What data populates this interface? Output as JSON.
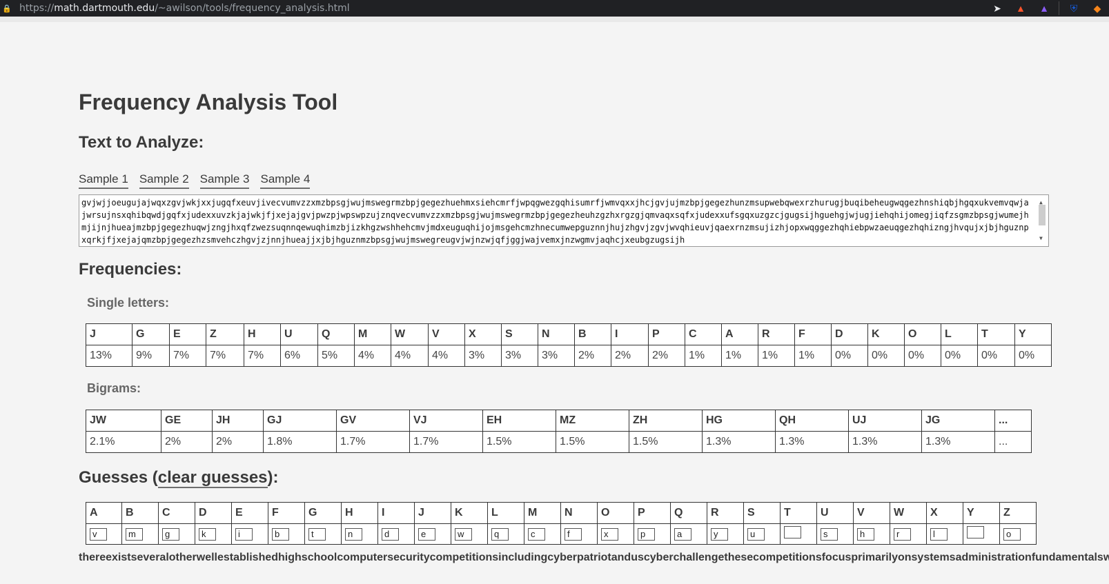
{
  "browser": {
    "url_prefix": "https://",
    "url_host": "math.dartmouth.edu",
    "url_path": "/~awilson/tools/frequency_analysis.html"
  },
  "page": {
    "title": "Frequency Analysis Tool",
    "text_heading": "Text to Analyze:",
    "samples": [
      "Sample 1",
      "Sample 2",
      "Sample 3",
      "Sample 4"
    ],
    "ciphertext": "gvjwjjoeugujajwqxzgvjwkjxxjugqfxeuvjivecvumvzzxmzbpsgjwujmswegrmzbpjgegezhuehmxsiehcmrfjwpqgwezgqhisumrfjwmvqxxjhcjgvjujmzbpjgegezhunzmsupwebqwexrzhurugjbuqibeheugwqgezhnshiqbjhgqxukvemvqwjajwrsujnsxqhibqwdjgqfxjudexxuvzkjajwkjfjxejajgvjpwzpjwpswpzujznqvecvumvzzxmzbpsgjwujmswegrmzbpjgegezheuhzgzhxrgzgjqmvaqxsqfxjudexxufsgqxuzgzcjgugsijhguehgjwjugjiehqhijomegjiqfzsgmzbpsgjwumejhmjijnjhueajmzbpjgegezhuqwjzngjhxqfzwezsuqnnqewuqhimzbjizkhgzwshhehcmvjmdxeuguqhijojmsgehcmzhnecumwepguznnjhujzhgvjzgvjwvqhieuvjqaexrnzmsujizhjopxwqggezhqhiebpwzaeuqgezhqhizngjhvqujxjbjhguznpxqrkjfjxejajqmzbpjgegezhzsmvehczhgvjzjnnjhueajjxjbjhguznmzbpsgjwujmswegreugvjwjnzwjqfjggjwajvemxjnzwgmvjaqhcjxeubgzugsijh",
    "frequencies_heading": "Frequencies:",
    "single_heading": "Single letters:",
    "bigrams_heading": "Bigrams:",
    "guesses_heading_pre": "Guesses (",
    "clear_label": "clear guesses",
    "guesses_heading_post": "):",
    "decoded": "thereexistseveralotherwellestablishedhighschoolcomputersecuritycompetitionsincludingcyberpatriotanduscyberchallengethesecompetitionsfocusprimarilyonsystemsadministrationfundamentalsw"
  },
  "single_letters": {
    "letters": [
      "J",
      "G",
      "E",
      "Z",
      "H",
      "U",
      "Q",
      "M",
      "W",
      "V",
      "X",
      "S",
      "N",
      "B",
      "I",
      "P",
      "C",
      "A",
      "R",
      "F",
      "D",
      "K",
      "O",
      "L",
      "T",
      "Y"
    ],
    "values": [
      "13%",
      "9%",
      "7%",
      "7%",
      "7%",
      "6%",
      "5%",
      "4%",
      "4%",
      "4%",
      "3%",
      "3%",
      "3%",
      "2%",
      "2%",
      "2%",
      "1%",
      "1%",
      "1%",
      "1%",
      "0%",
      "0%",
      "0%",
      "0%",
      "0%",
      "0%"
    ]
  },
  "bigrams": {
    "pairs": [
      "JW",
      "GE",
      "JH",
      "GJ",
      "GV",
      "VJ",
      "EH",
      "MZ",
      "ZH",
      "HG",
      "QH",
      "UJ",
      "JG",
      "..."
    ],
    "values": [
      "2.1%",
      "2%",
      "2%",
      "1.8%",
      "1.7%",
      "1.7%",
      "1.5%",
      "1.5%",
      "1.5%",
      "1.3%",
      "1.3%",
      "1.3%",
      "1.3%",
      "..."
    ]
  },
  "guesses": {
    "letters": [
      "A",
      "B",
      "C",
      "D",
      "E",
      "F",
      "G",
      "H",
      "I",
      "J",
      "K",
      "L",
      "M",
      "N",
      "O",
      "P",
      "Q",
      "R",
      "S",
      "T",
      "U",
      "V",
      "W",
      "X",
      "Y",
      "Z"
    ],
    "values": [
      "v",
      "m",
      "g",
      "k",
      "i",
      "b",
      "t",
      "n",
      "d",
      "e",
      "w",
      "q",
      "c",
      "f",
      "x",
      "p",
      "a",
      "y",
      "u",
      "",
      "s",
      "h",
      "r",
      "l",
      "",
      "o"
    ]
  }
}
